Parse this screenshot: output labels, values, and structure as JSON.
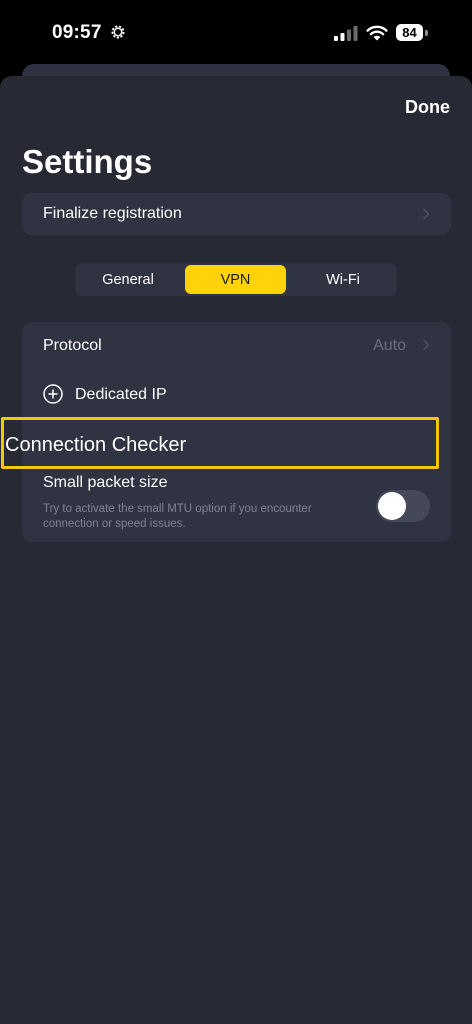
{
  "status_bar": {
    "time": "09:57",
    "battery": "84"
  },
  "header": {
    "done_label": "Done",
    "title": "Settings"
  },
  "registration": {
    "label": "Finalize registration"
  },
  "tabs": [
    {
      "label": "General",
      "active": false
    },
    {
      "label": "VPN",
      "active": true
    },
    {
      "label": "Wi-Fi",
      "active": false
    }
  ],
  "vpn_settings": {
    "protocol_label": "Protocol",
    "protocol_value": "Auto",
    "dedicated_ip_label": "Dedicated IP",
    "connection_checker_label": "Connection Checker",
    "small_packet_label": "Small packet size",
    "small_packet_description": "Try to activate the small MTU option if you encounter connection or speed issues.",
    "small_packet_enabled": false
  },
  "colors": {
    "accent": "#ffd20a",
    "highlight_border": "#f5c50b",
    "sheet_bg": "#272935",
    "card_bg": "#303341"
  }
}
